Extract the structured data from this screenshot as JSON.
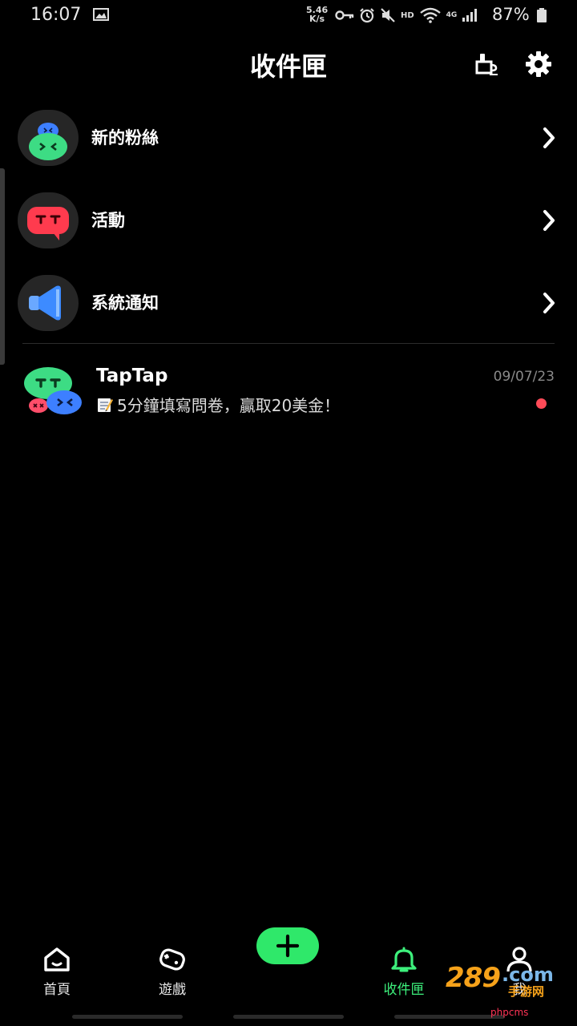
{
  "status_bar": {
    "time": "16:07",
    "net_speed_value": "5.46",
    "net_speed_unit": "K/s",
    "hd": "HD",
    "network": "4G",
    "battery": "87%"
  },
  "header": {
    "title": "收件匣"
  },
  "categories": [
    {
      "label": "新的粉絲",
      "icon": "green-bean-avatar",
      "color": "#3ddc84"
    },
    {
      "label": "活動",
      "icon": "red-bean-speech-avatar",
      "color": "#ff3b4e"
    },
    {
      "label": "系統通知",
      "icon": "blue-speaker-avatar",
      "color": "#3d8bff"
    }
  ],
  "messages": [
    {
      "sender": "TapTap",
      "date": "09/07/23",
      "preview": "5分鐘填寫問卷，贏取20美金！",
      "unread": true
    }
  ],
  "bottom_nav": {
    "items": [
      {
        "label": "首頁",
        "icon": "home-icon"
      },
      {
        "label": "遊戲",
        "icon": "gamepad-icon"
      },
      {
        "label": "收件匣",
        "icon": "bell-icon",
        "active": true
      },
      {
        "label": "我",
        "icon": "person-icon"
      }
    ],
    "fab_icon": "plus-icon"
  },
  "watermark": {
    "num": "289",
    "domain": ".com",
    "sub": "手游网",
    "site": "phpcms"
  },
  "colors": {
    "accent": "#2fe86a",
    "unread": "#ff4b58",
    "background": "#000000"
  }
}
